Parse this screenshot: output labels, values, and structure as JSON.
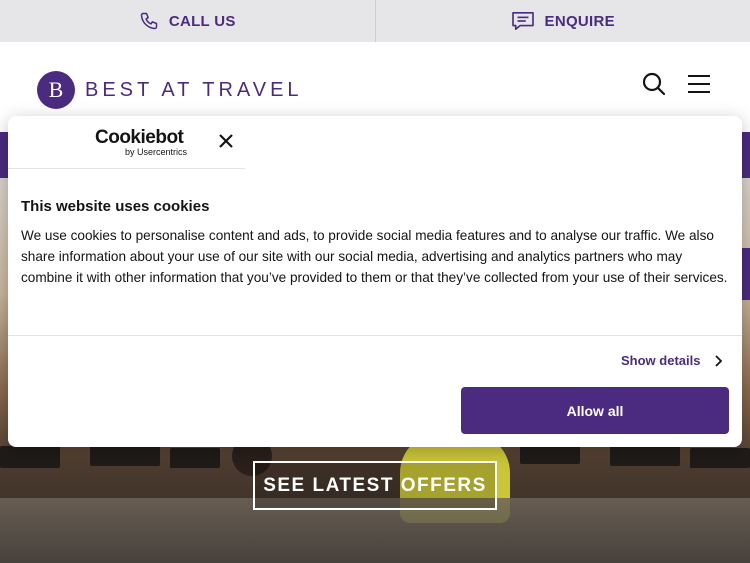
{
  "topbar": {
    "call_label": "CALL US",
    "call_icon": "phone-icon",
    "enquire_label": "ENQUIRE",
    "enquire_icon": "chat-icon"
  },
  "header": {
    "logo_text": "BEST AT TRAVEL",
    "logo_mark": "B",
    "search_icon": "search-icon",
    "menu_icon": "hamburger-menu-icon"
  },
  "hero": {
    "cta_label": "SEE LATEST OFFERS"
  },
  "cookie_dialog": {
    "brand": "Cookiebot",
    "brand_sub": "by Usercentrics",
    "title": "This website uses cookies",
    "body": "We use cookies to personalise content and ads, to provide social media features and to analyse our traffic. We also share information about your use of our site with our social media, advertising and analytics partners who may combine it with other information that you’ve provided to them or that they’ve collected from your use of their services.",
    "show_details_label": "Show details",
    "allow_all_label": "Allow all"
  },
  "colors": {
    "brand_purple": "#4b2b7f",
    "topbar_bg": "#e6e6e8",
    "text_dark": "#141414"
  }
}
